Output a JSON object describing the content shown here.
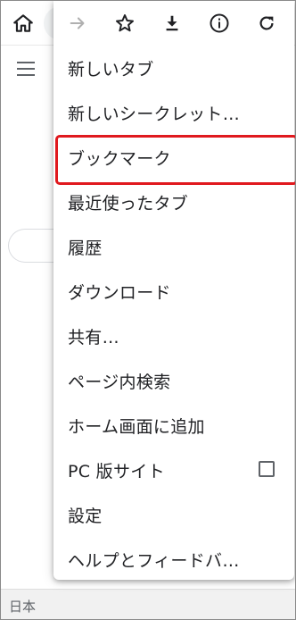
{
  "toolbar": {
    "home_icon": "home-icon"
  },
  "menu": {
    "icons": [
      {
        "name": "forward-icon",
        "enabled": false
      },
      {
        "name": "star-icon",
        "enabled": true
      },
      {
        "name": "download-icon",
        "enabled": true
      },
      {
        "name": "info-icon",
        "enabled": true
      },
      {
        "name": "reload-icon",
        "enabled": true
      }
    ],
    "items": [
      {
        "label": "新しいタブ"
      },
      {
        "label": "新しいシークレット…"
      },
      {
        "label": "ブックマーク",
        "highlighted": true
      },
      {
        "label": "最近使ったタブ"
      },
      {
        "label": "履歴"
      },
      {
        "label": "ダウンロード"
      },
      {
        "label": "共有…"
      },
      {
        "label": "ページ内検索"
      },
      {
        "label": "ホーム画面に追加"
      },
      {
        "label": "PC 版サイト",
        "checkbox": false
      },
      {
        "label": "設定"
      },
      {
        "label": "ヘルプとフィードバ…"
      }
    ],
    "highlight_color": "#e0191e"
  },
  "bottom_bar": {
    "text": "日本"
  }
}
